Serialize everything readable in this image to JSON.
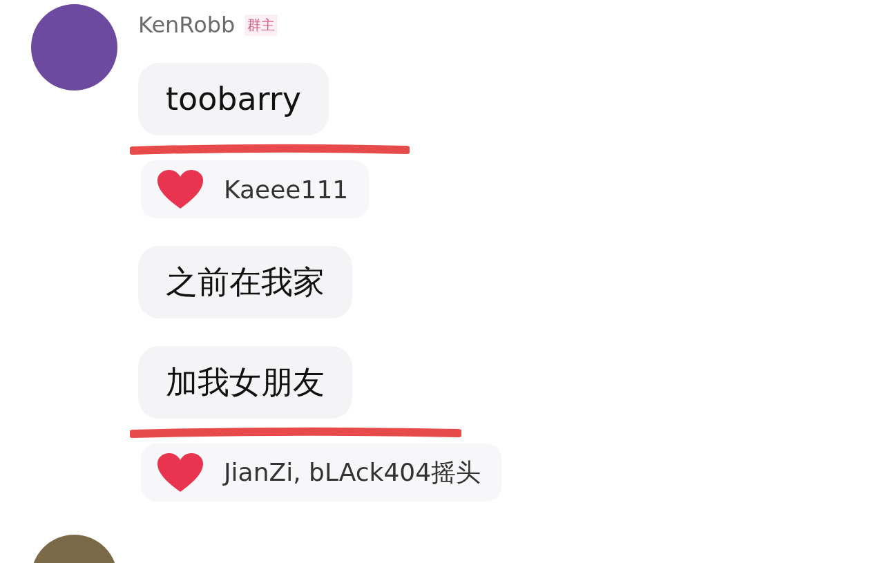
{
  "author": {
    "name": "KenRobb",
    "badge": "群主"
  },
  "messages": [
    {
      "text": "toobarry",
      "underlined": true,
      "reaction": "Kaeee111"
    },
    {
      "text": "之前在我家",
      "underlined": false
    },
    {
      "text": "加我女朋友",
      "underlined": true,
      "reaction": "JianZi, bLAck404摇头"
    }
  ]
}
